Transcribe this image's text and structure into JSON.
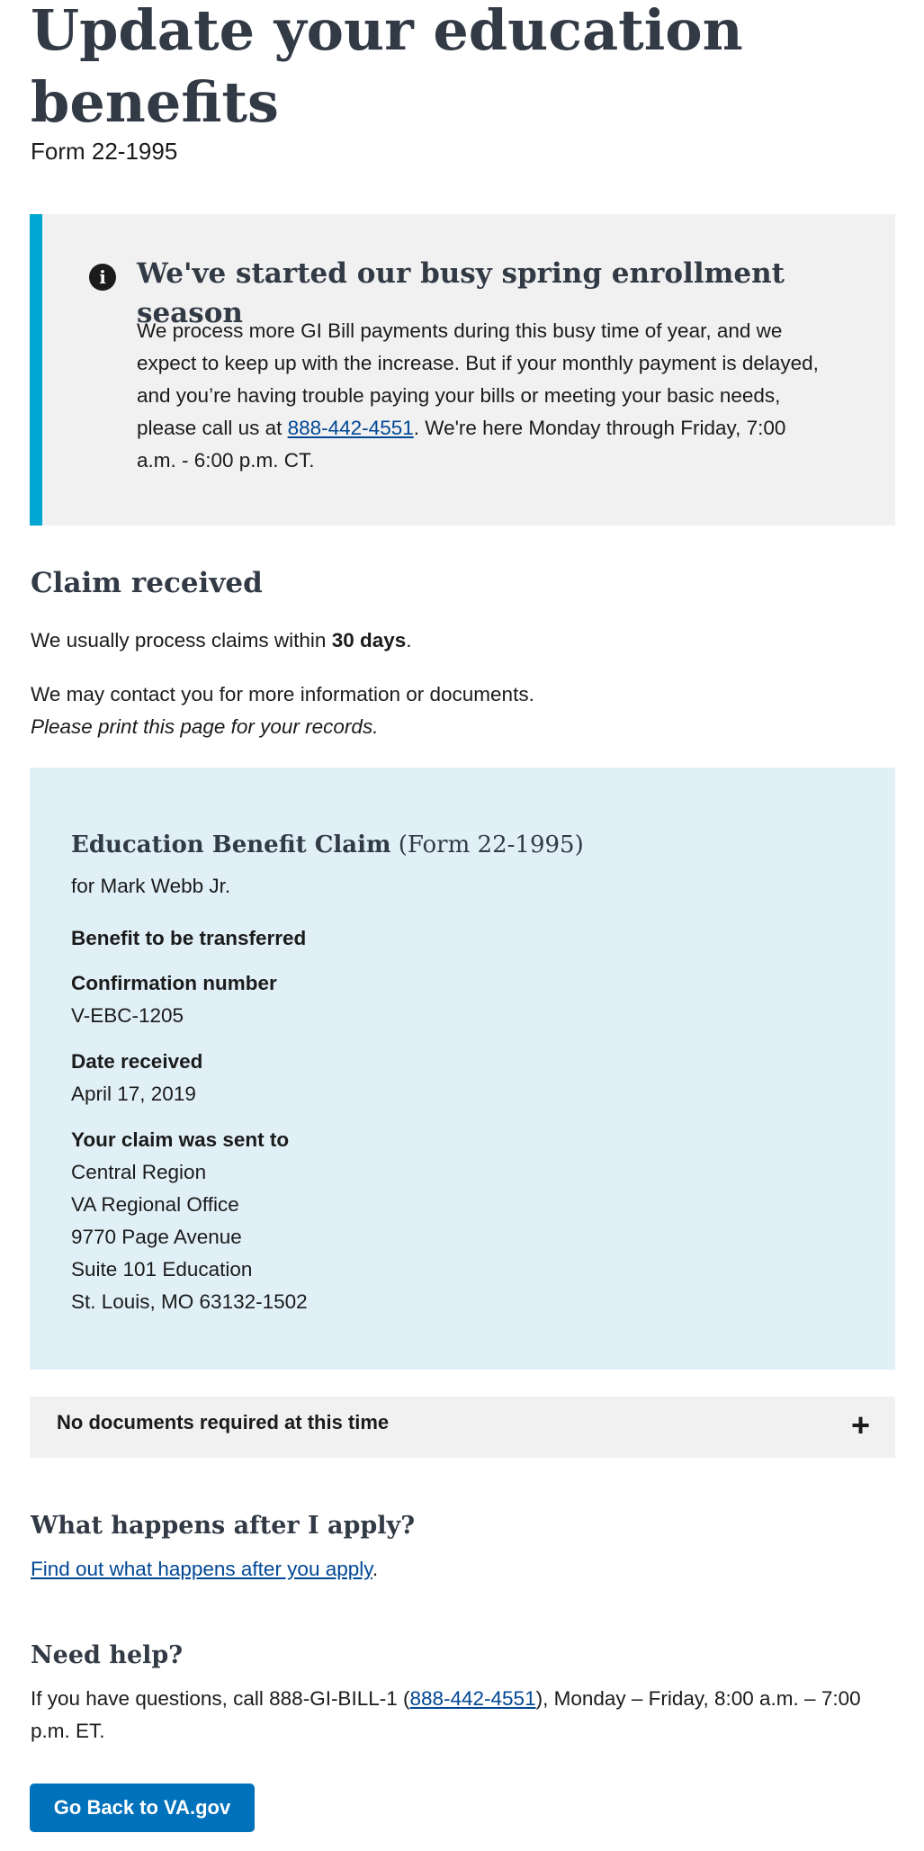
{
  "page": {
    "title": "Update your education benefits",
    "form_number": "Form 22-1995"
  },
  "alert": {
    "icon": "info-icon",
    "heading": "We've started our busy spring enrollment season",
    "body_before": "We process more GI Bill payments during this busy time of year, and we expect to keep up with the increase. But if your monthly payment is delayed, and you’re having trouble paying your bills or meeting your basic needs, please call us at ",
    "phone": "888-442-4551",
    "body_after": ". We're here Monday through Friday, 7:00 a.m. - 6:00 p.m. CT."
  },
  "claim_received": {
    "heading": "Claim received",
    "processing_before": "We usually process claims within ",
    "processing_days": "30 days",
    "processing_after": ".",
    "contact_note": "We may contact you for more information or documents.",
    "print_note": "Please print this page for your records."
  },
  "claim_box": {
    "title": "Education Benefit Claim",
    "form": "(Form 22-1995)",
    "for_name": "for Mark Webb Jr.",
    "benefit_label": "Benefit to be transferred",
    "confirmation_label": "Confirmation number",
    "confirmation_value": "V-EBC-1205",
    "date_label": "Date received",
    "date_value": "April 17, 2019",
    "sent_to_label": "Your claim was sent to",
    "address": [
      "Central Region",
      "VA Regional Office",
      "9770 Page Avenue",
      "Suite 101 Education",
      "St. Louis, MO 63132-1502"
    ]
  },
  "accordion": {
    "label": "No documents required at this time",
    "icon": "plus-icon"
  },
  "after_apply": {
    "heading": "What happens after I apply?",
    "link": "Find out what happens after you apply",
    "link_after": "."
  },
  "help": {
    "heading": "Need help?",
    "text_before": "If you have questions, call 888-GI-BILL-1 (",
    "phone": "888-442-4551",
    "text_after": "), Monday – Friday, 8:00 a.m. – 7:00 p.m. ET."
  },
  "button": {
    "label": "Go Back to VA.gov"
  },
  "colors": {
    "alert_border": "#00a6d2",
    "alert_bg": "#f1f1f1",
    "claim_box_bg": "#e1f0f7",
    "link": "#004795",
    "button_bg": "#0071bb"
  }
}
